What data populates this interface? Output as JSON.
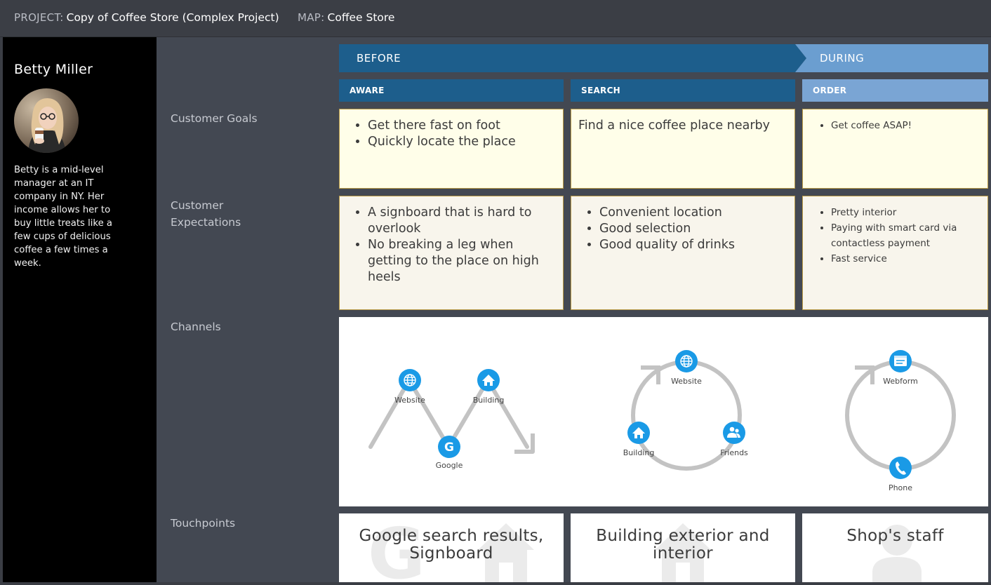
{
  "header": {
    "project_label": "PROJECT:",
    "project_name": "Copy of Coffee Store (Complex Project)",
    "map_label": "MAP:",
    "map_name": "Coffee Store"
  },
  "persona": {
    "name": "Betty Miller",
    "description": "Betty is a mid-level manager at an IT company in NY. Her income allows her to buy little treats like a few cups of delicious coffee a few times a week."
  },
  "row_labels": {
    "goals": "Customer Goals",
    "expectations_line1": "Customer",
    "expectations_line2": "Expectations",
    "channels": "Channels",
    "touchpoints": "Touchpoints"
  },
  "phases": [
    {
      "label": "BEFORE",
      "color": "#1d5e8c"
    },
    {
      "label": "DURING",
      "color": "#6b9ed0"
    }
  ],
  "stages": [
    {
      "label": "AWARE",
      "color": "#1d5e8c",
      "goals": [
        "Get there fast on foot",
        "Quickly locate the place"
      ],
      "expectations": [
        "A signboard that is hard to overlook",
        "No breaking a leg when getting to the place on high heels"
      ],
      "channels": [
        "Website",
        "Building",
        "Google"
      ],
      "touchpoint": "Google search results, Signboard"
    },
    {
      "label": "SEARCH",
      "color": "#1d5e8c",
      "goal_text": "Find a nice coffee place nearby",
      "expectations": [
        "Convenient location",
        "Good selection",
        "Good quality of drinks"
      ],
      "channels": [
        "Website",
        "Building",
        "Friends"
      ],
      "touchpoint": "Building exterior and interior"
    },
    {
      "label": "ORDER",
      "color": "#7aa5d4",
      "goals": [
        "Get coffee ASAP!"
      ],
      "expectations": [
        "Pretty interior",
        "Paying with smart card via contactless payment",
        "Fast service"
      ],
      "channels": [
        "Webform",
        "Phone"
      ],
      "touchpoint": "Shop's staff"
    }
  ],
  "colors": {
    "channel_icon": "#1a9ae6",
    "channel_path": "#c3c3c3"
  }
}
